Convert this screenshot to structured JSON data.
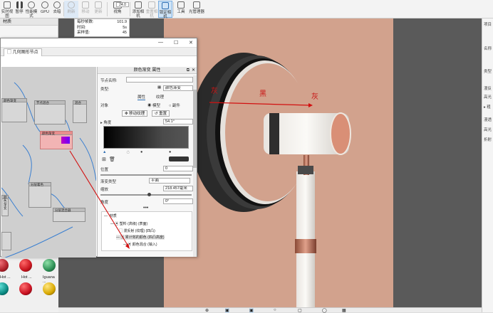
{
  "toolbar": {
    "items": [
      {
        "label": "实时视图",
        "icon": "realtime-view-icon"
      },
      {
        "label": "暂停",
        "icon": "pause-icon"
      },
      {
        "label": "性能模式",
        "icon": "performance-icon"
      },
      {
        "label": "GPU",
        "icon": "gpu-icon"
      },
      {
        "label": "去暗",
        "icon": "denoise-icon"
      },
      {
        "label": "刷新",
        "icon": "refresh-icon"
      },
      {
        "label": "移动",
        "icon": "move-icon"
      },
      {
        "label": "更新",
        "icon": "update-icon"
      },
      {
        "label": "视角",
        "icon": "view-angle-icon"
      },
      {
        "label": "添加相机",
        "icon": "add-camera-icon"
      },
      {
        "label": "重置相机",
        "icon": "reset-camera-icon"
      },
      {
        "label": "锁定相机",
        "icon": "lock-camera-icon"
      },
      {
        "label": "工具",
        "icon": "tools-icon"
      },
      {
        "label": "光管理器",
        "icon": "light-manager-icon"
      }
    ],
    "fov_value": "24.0"
  },
  "left_panel": {
    "title": "材质"
  },
  "stats": {
    "rows": [
      {
        "k": "每秒帧数:",
        "v": "101.9"
      },
      {
        "k": "时间:",
        "v": "5s"
      },
      {
        "k": "采样值:",
        "v": "45"
      }
    ]
  },
  "window": {
    "tab": "几何图形节点",
    "min": "—",
    "max": "☐",
    "close": "✕"
  },
  "props": {
    "header": "颜色渐变 属性",
    "node_name_label": "节点名称:",
    "type_label": "类型:",
    "type_value": "颜色渐变",
    "tabs": [
      "属性",
      "纹理"
    ],
    "mapping_label": "对象",
    "radio_model": "模型",
    "radio_world": "副件",
    "move_texture": "移动纹理",
    "reset": "重置",
    "angle_label": "▸ 角度",
    "angle_value": "54.1°",
    "position_label": "位置",
    "position_value": "0",
    "gradient_type_label": "渐变类型",
    "gradient_type_value": "平面",
    "scale_label": "缩放",
    "scale_value": "218.457毫米",
    "angle2_label": "角度",
    "angle2_value": "0°",
    "tree": [
      "材质",
      "塑料 (高级) (表面)",
      "漫反射 (纹理) (四凸)",
      "累计效的颜色 (四凸高度)",
      "颜色混合 (输入)"
    ]
  },
  "graph_nodes": [
    {
      "title": "颜色渐变"
    },
    {
      "title": "节点混合"
    },
    {
      "title": "混合"
    },
    {
      "title": "颜色渐变"
    },
    {
      "title": "分层着色"
    },
    {
      "title": "颜色渐变"
    },
    {
      "title": "分层混合器"
    }
  ],
  "materials": [
    {
      "label": "Hot ...",
      "color": "#b0202a"
    },
    {
      "label": "Hot ...",
      "color": "#c8141e"
    },
    {
      "label": "Iguana ...",
      "color": "#2d8f55"
    }
  ],
  "scene_labels": {
    "left": "灰",
    "center": "黑",
    "right": "灰"
  },
  "right_panel": {
    "items": [
      "项目",
      "名称",
      "类型",
      "漫反",
      "高光",
      "▸ 粗",
      "漫透",
      "高光",
      "折射"
    ]
  }
}
